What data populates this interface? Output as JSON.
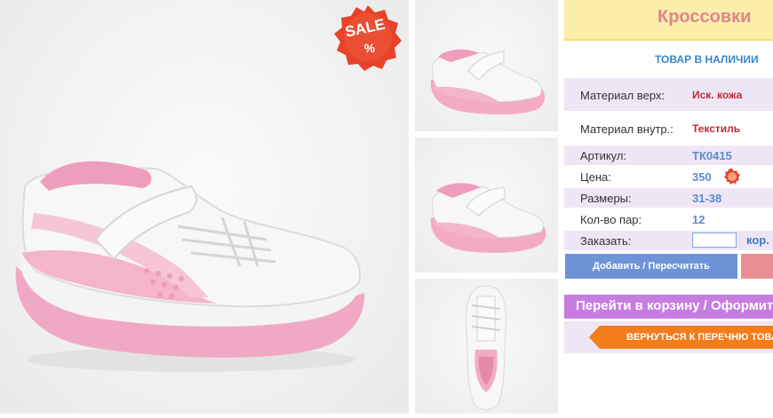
{
  "product": {
    "title": "Кроссовки",
    "stock_status": "ТОВАР В НАЛИЧИИ",
    "sale_badge": "SALE",
    "sale_percent": "%"
  },
  "params": [
    {
      "label": "Материал верх:",
      "value": "Иск. кожа"
    },
    {
      "label": "Материал внутр.:",
      "value": "Текстиль"
    },
    {
      "label": "Артикул:",
      "value": "ТК0415"
    },
    {
      "label": "Цена:",
      "value": "350"
    },
    {
      "label": "Размеры:",
      "value": "31-38"
    },
    {
      "label": "Кол-во пар:",
      "value": "12"
    },
    {
      "label": "Заказать:",
      "value": ""
    }
  ],
  "order": {
    "input_value": "",
    "cart_label": "кор."
  },
  "buttons": {
    "add_recalc": "Добавить / Пересчитать",
    "checkout": "Перейти в корзину / Оформить",
    "back": "ВЕРНУТЬСЯ К ПЕРЕЧНЮ ТОВАРОВ"
  },
  "icons": {
    "price_badge": "sale-mini-icon"
  },
  "colors": {
    "title_bg": "#fbeeaa",
    "title_text": "#e0848f",
    "lilac_row": "#efe6f5",
    "link_blue": "#5b8bd0",
    "red_value": "#c0283a",
    "sale_red": "#e8432a",
    "add_button": "#6e93d6",
    "checkout_bar": "#c77ce0",
    "back_button": "#f47c1a"
  }
}
